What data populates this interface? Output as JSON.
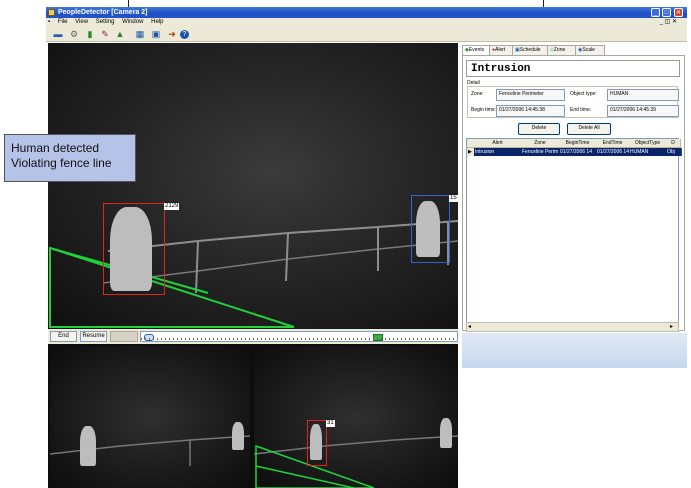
{
  "window": {
    "title": "PeopleDetector  [Camera 2]",
    "min_glyph": "_",
    "max_glyph": "□",
    "close_glyph": "✕",
    "inner_controls": "_ ◫ ✕"
  },
  "menu": [
    "File",
    "View",
    "Setting",
    "Window",
    "Help"
  ],
  "toolbar_icons": [
    "camera-icon",
    "wrench-icon",
    "chart-icon",
    "tools-icon",
    "map-icon",
    "grid-icon",
    "display-icon",
    "exit-icon",
    "help-icon"
  ],
  "main_video": {
    "callout": "Human detected\nViolating fence line",
    "detections": [
      {
        "id": "2129",
        "color": "#e0261c"
      },
      {
        "id": "15",
        "color": "#3a5fd0"
      }
    ],
    "zone_color": "#1fd23a"
  },
  "controls": {
    "end_label": "End",
    "resume_label": "Resume"
  },
  "thumbnails": [
    {
      "label": "thumb-1"
    },
    {
      "label": "thumb-2",
      "detection_id": "31"
    }
  ],
  "panel": {
    "tabs": [
      "Events",
      "Alert",
      "Schedule",
      "Zone",
      "Scale"
    ],
    "event_title": "Intrusion",
    "detail_label": "Detail",
    "zone_label": "Zone:",
    "zone_value": "Fenceline Perimeter",
    "object_type_label": "Object type:",
    "object_type_value": "HUMAN",
    "begin_label": "Begin time:",
    "begin_value": "01/27/2006 14:45:38",
    "end_label": "End time:",
    "end_value": "01/27/2006 14:45:39",
    "delete_label": "Delete",
    "delete_all_label": "Delete All",
    "grid_columns": [
      "",
      "Alert",
      "Zone",
      "BeginTime",
      "EndTime",
      "ObjectType",
      "D"
    ],
    "grid_row": [
      "▶",
      "Intrusion",
      "Fenceline Perim",
      "01/27/2006 14",
      "01/27/2006 14",
      "HUMAN",
      "Obj"
    ]
  }
}
